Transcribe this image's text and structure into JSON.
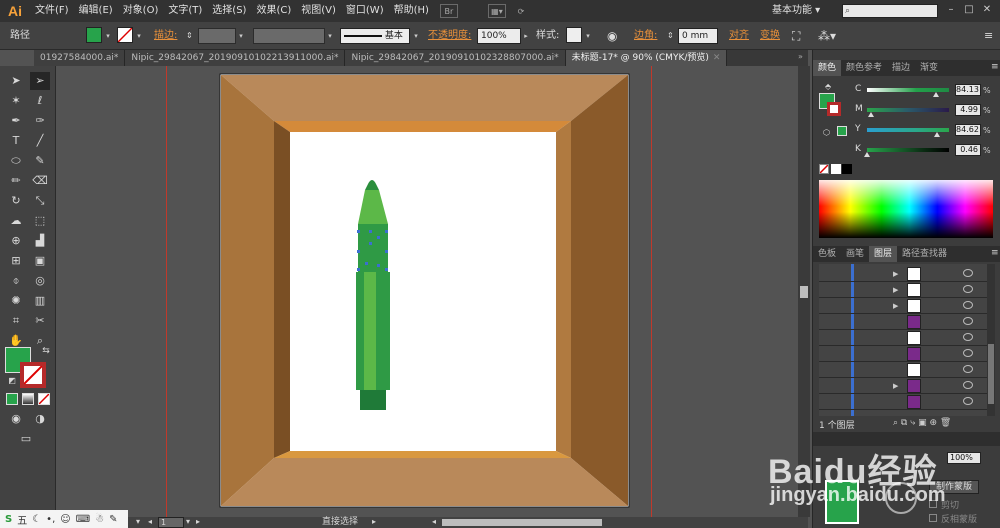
{
  "app": {
    "logo": "Ai",
    "workspace": "基本功能"
  },
  "menu": [
    "文件(F)",
    "编辑(E)",
    "对象(O)",
    "文字(T)",
    "选择(S)",
    "效果(C)",
    "视图(V)",
    "窗口(W)",
    "帮助(H)"
  ],
  "menubar_icons": {
    "bridge": "Br"
  },
  "control": {
    "selection_type": "路径",
    "stroke_label": "描边:",
    "stroke_style": "基本",
    "opacity_label": "不透明度:",
    "opacity_value": "100%",
    "style_label": "样式:",
    "corner_label": "边角:",
    "corner_value": "0 mm",
    "align_link": "对齐",
    "transform_link": "变换"
  },
  "tabs": [
    {
      "label": "01927584000.ai*",
      "active": false
    },
    {
      "label": "Nipic_29842067_20190910102213911000.ai*",
      "active": false
    },
    {
      "label": "Nipic_29842067_20190910102328807000.ai*",
      "active": false
    },
    {
      "label": "未标题-17* @ 90% (CMYK/预览)",
      "active": true
    }
  ],
  "color_panel": {
    "tabs": [
      "颜色",
      "颜色参考",
      "描边",
      "渐变"
    ],
    "channels": [
      {
        "name": "C",
        "value": "84.13",
        "level": 0.84,
        "gradient": "linear-gradient(to right,#ffffff,#23a04a 60%,#1f8a44)"
      },
      {
        "name": "M",
        "value": "4.99",
        "level": 0.05,
        "gradient": "linear-gradient(to right,#2aa54b,#2a5a6a 50%,#2a1a4a)"
      },
      {
        "name": "Y",
        "value": "84.62",
        "level": 0.85,
        "gradient": "linear-gradient(to right,#2a9fd0,#2aa88a 60%,#2aa54b)"
      },
      {
        "name": "K",
        "value": "0.46",
        "level": 0.005,
        "gradient": "linear-gradient(to right,#27a34b,#0a2a12 70%,#000000)"
      }
    ],
    "fill_color": "#27a34b"
  },
  "layers_panel": {
    "tabs": [
      "色板",
      "画笔",
      "图层",
      "路径查找器"
    ],
    "footer": "1 个图层",
    "rows": [
      {
        "thumb": "#ffffff",
        "disclose": true
      },
      {
        "thumb": "#ffffff",
        "disclose": true
      },
      {
        "thumb": "#ffffff",
        "disclose": true
      },
      {
        "thumb": "#7a2a8a",
        "disclose": false
      },
      {
        "thumb": "#ffffff",
        "disclose": false
      },
      {
        "thumb": "#7a2a8a",
        "disclose": false
      },
      {
        "thumb": "#ffffff",
        "disclose": false
      },
      {
        "thumb": "#7a2a8a",
        "disclose": true
      },
      {
        "thumb": "#7a2a8a",
        "disclose": false
      }
    ]
  },
  "transparency_panel": {
    "opacity_value": "100%",
    "make_mask_button": "制作蒙版",
    "clip_label": "剪切",
    "invert_mask_label": "反相蒙版"
  },
  "status": {
    "zoom": "90%",
    "page": "1",
    "tool_name": "直接选择"
  },
  "taskbar": {
    "ime": "五"
  },
  "watermark": {
    "logo": "Baidu经验",
    "url": "jingyan.baidu.com"
  },
  "colors": {
    "accent_orange": "#e8903a",
    "fill_green": "#27a34b",
    "frame_top": "#b9895a",
    "frame_left": "#a8743c",
    "frame_right": "#8a5a2a"
  }
}
